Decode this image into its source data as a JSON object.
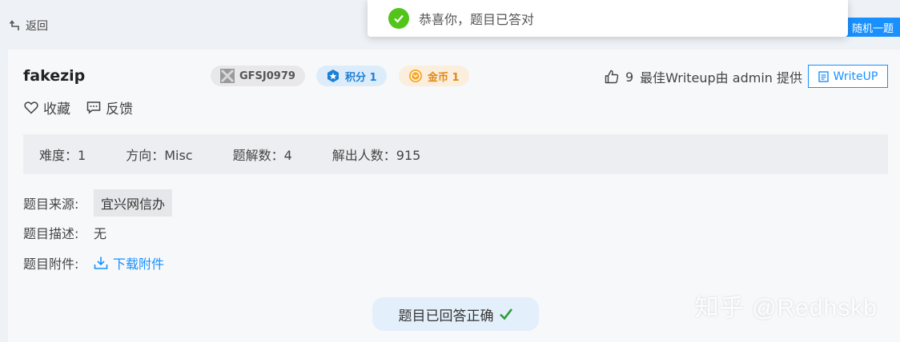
{
  "nav": {
    "back_label": "返回",
    "random_label": "随机一题"
  },
  "toast": {
    "message": "恭喜你，题目已答对"
  },
  "challenge": {
    "title": "fakezip",
    "id_tag": "GFSJ0979",
    "score_tag": "积分 1",
    "coin_tag": "金币 1",
    "likes": "9",
    "best_writeup_text": "最佳Writeup由 admin 提供",
    "writeup_button": "WriteUP"
  },
  "actions": {
    "favorite_label": "收藏",
    "feedback_label": "反馈"
  },
  "stats": {
    "difficulty": "难度：1",
    "direction": "方向：Misc",
    "solutions": "题解数：4",
    "solvers": "解出人数：915"
  },
  "details": {
    "source_label": "题目来源:",
    "source_value": "宜兴网信办",
    "desc_label": "题目描述:",
    "desc_value": "无",
    "attach_label": "题目附件:",
    "attach_link": "下载附件"
  },
  "answer_status": "题目已回答正确",
  "watermark": "知乎 @Redhskb",
  "colors": {
    "accent": "#1890ff",
    "success": "#52c41a",
    "coin": "#e08a14"
  }
}
